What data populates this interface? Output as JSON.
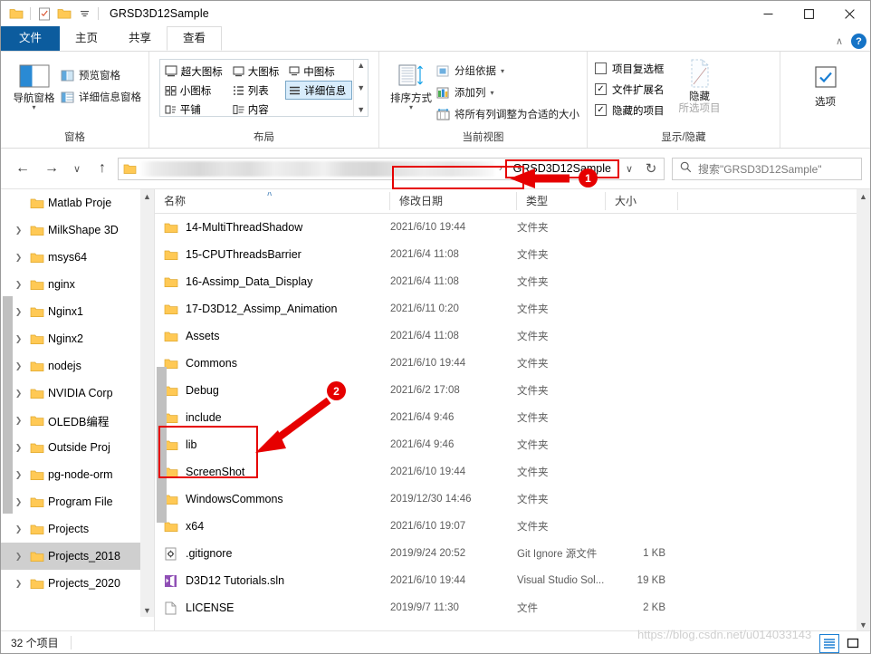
{
  "window": {
    "title": "GRSD3D12Sample",
    "quick_access": [
      "folder-icon",
      "properties-checkbox-icon",
      "new-folder-icon",
      "dropdown-caret-icon"
    ],
    "controls": {
      "minimize": "—",
      "maximize": "□",
      "close": "✕"
    }
  },
  "ribbon": {
    "tabs": [
      {
        "label": "文件",
        "kind": "file"
      },
      {
        "label": "主页",
        "kind": "normal"
      },
      {
        "label": "共享",
        "kind": "normal"
      },
      {
        "label": "查看",
        "kind": "active"
      }
    ],
    "collapse_caret": "∧",
    "help_label": "?",
    "groups": [
      {
        "name": "panes",
        "label": "窗格",
        "big_button": {
          "label": "导航窗格",
          "caret": "▾"
        },
        "items": [
          {
            "label": "预览窗格",
            "icon": "preview-pane-icon"
          },
          {
            "label": "详细信息窗格",
            "icon": "details-pane-icon"
          }
        ]
      },
      {
        "name": "layout",
        "label": "布局",
        "gallery": [
          {
            "label": "超大图标",
            "selected": false
          },
          {
            "label": "大图标",
            "selected": false
          },
          {
            "label": "中图标",
            "selected": false
          },
          {
            "label": "小图标",
            "selected": false
          },
          {
            "label": "列表",
            "selected": false
          },
          {
            "label": "详细信息",
            "selected": true
          },
          {
            "label": "平铺",
            "selected": false
          },
          {
            "label": "内容",
            "selected": false
          }
        ]
      },
      {
        "name": "current-view",
        "label": "当前视图",
        "big_button": {
          "label": "排序方式",
          "caret": "▾"
        },
        "items": [
          {
            "label": "分组依据",
            "icon": "group-by-icon",
            "caret": "▾"
          },
          {
            "label": "添加列",
            "icon": "add-column-icon",
            "caret": "▾"
          },
          {
            "label": "将所有列调整为合适的大小",
            "icon": "size-columns-icon",
            "caret": ""
          }
        ]
      },
      {
        "name": "show-hide",
        "label": "显示/隐藏",
        "checkboxes": [
          {
            "label": "项目复选框",
            "checked": false
          },
          {
            "label": "文件扩展名",
            "checked": true
          },
          {
            "label": "隐藏的项目",
            "checked": true
          }
        ],
        "hide_button": {
          "label": "隐藏",
          "sub_label": "所选项目"
        }
      },
      {
        "name": "options",
        "label": "",
        "big_button": {
          "label": "选项",
          "caret": ""
        }
      }
    ]
  },
  "navbar": {
    "back": "←",
    "forward": "→",
    "recent": "∨",
    "up": "↑",
    "breadcrumb_current": "GRSD3D12Sample",
    "breadcrumb_sep": "›",
    "history_caret": "∨",
    "refresh": "↻",
    "search_placeholder": "搜索\"GRSD3D12Sample\""
  },
  "sidebar": {
    "items": [
      {
        "label": "Matlab Proje",
        "expandable": false,
        "selected": false
      },
      {
        "label": "MilkShape 3D",
        "expandable": true,
        "selected": false
      },
      {
        "label": "msys64",
        "expandable": true,
        "selected": false
      },
      {
        "label": "nginx",
        "expandable": true,
        "selected": false
      },
      {
        "label": "Nginx1",
        "expandable": true,
        "selected": false
      },
      {
        "label": "Nginx2",
        "expandable": true,
        "selected": false
      },
      {
        "label": "nodejs",
        "expandable": true,
        "selected": false
      },
      {
        "label": "NVIDIA Corp",
        "expandable": true,
        "selected": false
      },
      {
        "label": "OLEDB编程",
        "expandable": true,
        "selected": false
      },
      {
        "label": "Outside Proj",
        "expandable": true,
        "selected": false
      },
      {
        "label": "pg-node-orm",
        "expandable": true,
        "selected": false
      },
      {
        "label": "Program File",
        "expandable": true,
        "selected": false
      },
      {
        "label": "Projects",
        "expandable": true,
        "selected": false
      },
      {
        "label": "Projects_2018",
        "expandable": true,
        "selected": true
      },
      {
        "label": "Projects_2020",
        "expandable": true,
        "selected": false
      }
    ]
  },
  "filelist": {
    "columns": [
      {
        "label": "名称"
      },
      {
        "label": "修改日期"
      },
      {
        "label": "类型"
      },
      {
        "label": "大小"
      },
      {
        "label": ""
      }
    ],
    "sort_indicator": "∧",
    "rows": [
      {
        "name": "14-MultiThreadShadow",
        "date": "2021/6/10 19:44",
        "type": "文件夹",
        "size": "",
        "icon": "folder-icon"
      },
      {
        "name": "15-CPUThreadsBarrier",
        "date": "2021/6/4 11:08",
        "type": "文件夹",
        "size": "",
        "icon": "folder-icon"
      },
      {
        "name": "16-Assimp_Data_Display",
        "date": "2021/6/4 11:08",
        "type": "文件夹",
        "size": "",
        "icon": "folder-icon"
      },
      {
        "name": "17-D3D12_Assimp_Animation",
        "date": "2021/6/11 0:20",
        "type": "文件夹",
        "size": "",
        "icon": "folder-icon"
      },
      {
        "name": "Assets",
        "date": "2021/6/4 11:08",
        "type": "文件夹",
        "size": "",
        "icon": "folder-icon"
      },
      {
        "name": "Commons",
        "date": "2021/6/10 19:44",
        "type": "文件夹",
        "size": "",
        "icon": "folder-icon"
      },
      {
        "name": "Debug",
        "date": "2021/6/2 17:08",
        "type": "文件夹",
        "size": "",
        "icon": "folder-icon"
      },
      {
        "name": "include",
        "date": "2021/6/4 9:46",
        "type": "文件夹",
        "size": "",
        "icon": "folder-icon"
      },
      {
        "name": "lib",
        "date": "2021/6/4 9:46",
        "type": "文件夹",
        "size": "",
        "icon": "folder-icon"
      },
      {
        "name": "ScreenShot",
        "date": "2021/6/10 19:44",
        "type": "文件夹",
        "size": "",
        "icon": "folder-icon"
      },
      {
        "name": "WindowsCommons",
        "date": "2019/12/30 14:46",
        "type": "文件夹",
        "size": "",
        "icon": "folder-icon"
      },
      {
        "name": "x64",
        "date": "2021/6/10 19:07",
        "type": "文件夹",
        "size": "",
        "icon": "folder-icon"
      },
      {
        "name": ".gitignore",
        "date": "2019/9/24 20:52",
        "type": "Git Ignore 源文件",
        "size": "1 KB",
        "icon": "gitignore-file-icon"
      },
      {
        "name": "D3D12 Tutorials.sln",
        "date": "2021/6/10 19:44",
        "type": "Visual Studio Sol...",
        "size": "19 KB",
        "icon": "sln-file-icon"
      },
      {
        "name": "LICENSE",
        "date": "2019/9/7 11:30",
        "type": "文件",
        "size": "2 KB",
        "icon": "generic-file-icon"
      }
    ]
  },
  "status": {
    "item_count": "32 个项目",
    "view_details_icon": "details-view-icon",
    "view_large_icon": "large-icons-view-icon"
  },
  "annotations": [
    {
      "id": "1",
      "number": "1",
      "target": "breadcrumb_current"
    },
    {
      "id": "2",
      "number": "2",
      "target": "include_lib_rows"
    }
  ],
  "watermark": {
    "text": "https://blog.csdn.net/u014033143"
  },
  "colors": {
    "file_tab_blue": "#0c5c9e",
    "accent_blue": "#1a7fd4",
    "annotation_red": "#e60000",
    "folder_yellow": "#ffc955",
    "selection_gray": "#cfcfcf"
  }
}
